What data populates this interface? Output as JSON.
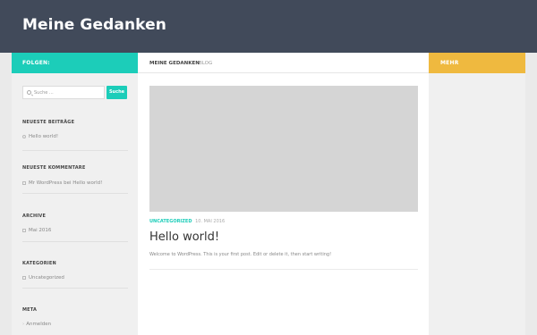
{
  "header": {
    "site_title": "Meine Gedanken"
  },
  "follow_bar": {
    "label": "FOLGEN:"
  },
  "more_bar": {
    "label": "MEHR"
  },
  "search": {
    "placeholder": "Suche ...",
    "button_label": "Suche"
  },
  "content_header": {
    "site": "MEINE GEDANKEN",
    "blog": "BLOG"
  },
  "post": {
    "category": "UNCATEGORIZED",
    "date": "10. MAI 2016",
    "title": "Hello world!",
    "excerpt": "Welcome to WordPress. This is your first post. Edit or delete it, then start writing!"
  },
  "widgets": {
    "recent_posts": {
      "title": "NEUESTE BEITRÄGE",
      "items": [
        "Hello world!"
      ]
    },
    "recent_comments": {
      "title": "NEUESTE KOMMENTARE",
      "author": "Mr WordPress",
      "connector": "bei",
      "post": "Hello world!"
    },
    "archive": {
      "title": "ARCHIVE",
      "items": [
        "Mai 2016"
      ]
    },
    "categories": {
      "title": "KATEGORIEN",
      "items": [
        "Uncategorized"
      ]
    },
    "meta": {
      "title": "META",
      "items": [
        "Anmelden"
      ]
    }
  },
  "colors": {
    "header_bg": "#414a5a",
    "accent": "#1ccdb9",
    "more": "#efb93f"
  }
}
